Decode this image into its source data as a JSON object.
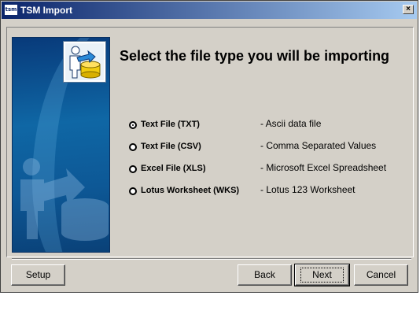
{
  "window": {
    "title": "TSM Import",
    "app_icon_text": "tsm",
    "close_glyph": "×"
  },
  "wizard": {
    "heading": "Select the file type you will be importing",
    "options": [
      {
        "label": "Text File (TXT)",
        "description": "- Ascii data file",
        "selected": true
      },
      {
        "label": "Text File (CSV)",
        "description": "- Comma Separated Values",
        "selected": false
      },
      {
        "label": "Excel File (XLS)",
        "description": "- Microsoft Excel Spreadsheet",
        "selected": false
      },
      {
        "label": "Lotus Worksheet (WKS)",
        "description": "- Lotus 123 Worksheet",
        "selected": false
      }
    ]
  },
  "buttons": {
    "setup": "Setup",
    "back": "Back",
    "next": "Next",
    "cancel": "Cancel"
  },
  "icons": {
    "badge": "import-person-database-icon",
    "background": "person-database-silhouette-icon"
  },
  "colors": {
    "titlebar_start": "#0a246a",
    "titlebar_end": "#a6caf0",
    "dialog_bg": "#d4d0c8",
    "side_panel": "#0f67a5"
  }
}
